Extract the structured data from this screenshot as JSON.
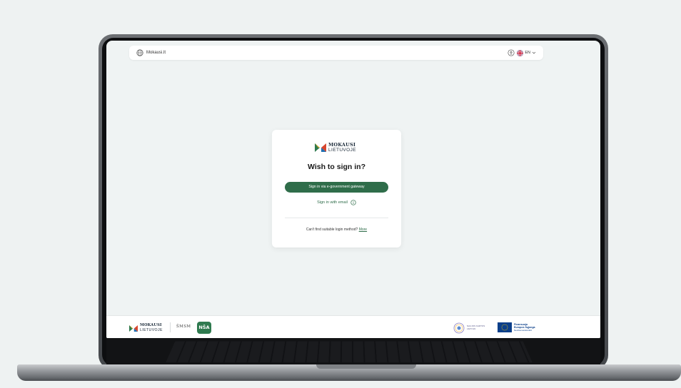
{
  "topbar": {
    "site_name": "Mokausi.lt",
    "language": "EN"
  },
  "brand": {
    "logo_line1": "MOKAUSI",
    "logo_line2": "LIETUVOJE"
  },
  "login": {
    "title": "Wish to sign in?",
    "egov_button": "Sign in via e-government gateway",
    "email_link": "Sign in with email",
    "footer_text": "Can't find suitable login method?",
    "more_link": "More"
  },
  "footer": {
    "smsm_label": "ŠMSM",
    "nsa_label": "NŠA",
    "recovery_line1": "NAUJOS KARTOS",
    "recovery_line2": "LIETUVA",
    "eu_line1": "Finansuoja",
    "eu_line2": "Europos Sąjunga",
    "eu_line3": "NextGenerationEU"
  },
  "colors": {
    "accent_green": "#2f6d4a",
    "background": "#eff3f3"
  }
}
